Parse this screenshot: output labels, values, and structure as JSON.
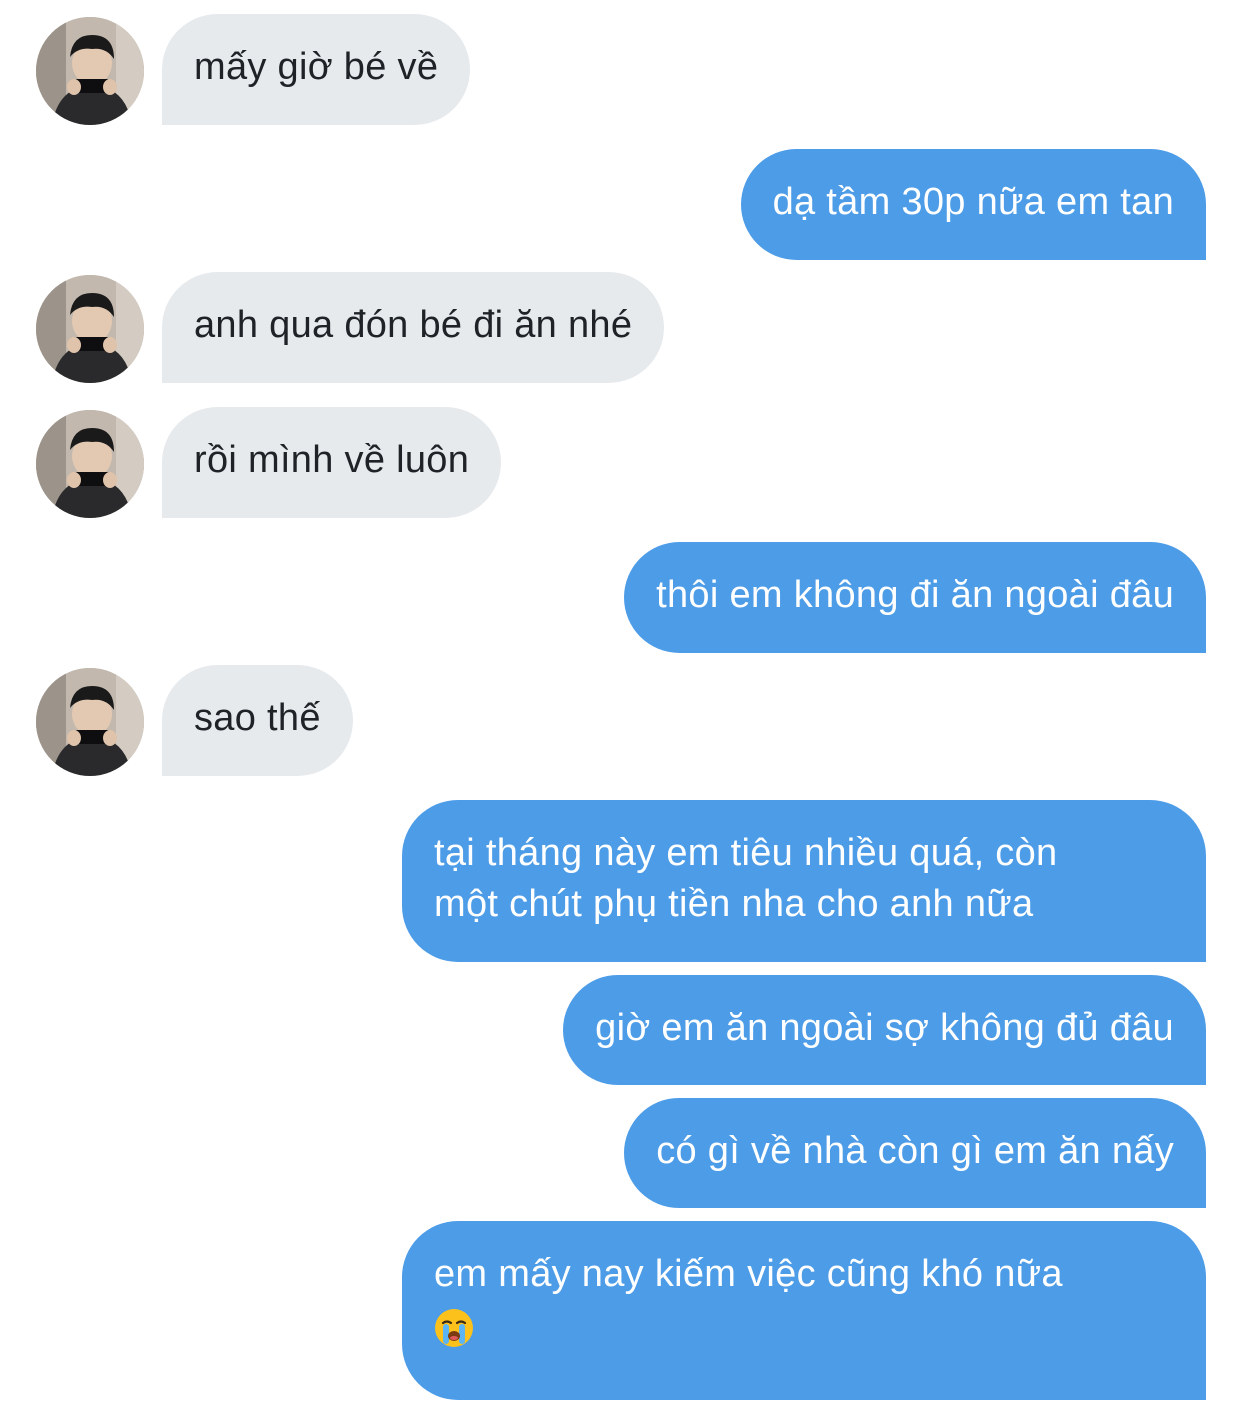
{
  "conversation": {
    "messages": [
      {
        "direction": "incoming",
        "text": "mấy giờ bé về"
      },
      {
        "direction": "outgoing",
        "text": "dạ tầm 30p nữa em tan"
      },
      {
        "direction": "incoming",
        "text": "anh qua đón bé đi ăn nhé"
      },
      {
        "direction": "incoming",
        "text": "rồi mình về luôn"
      },
      {
        "direction": "outgoing",
        "text": "thôi em không đi ăn ngoài đâu"
      },
      {
        "direction": "incoming",
        "text": "sao thế"
      },
      {
        "direction": "outgoing",
        "lines": [
          "tại tháng này em tiêu nhiều quá, còn",
          "một chút phụ tiền nha cho anh nữa"
        ]
      },
      {
        "direction": "outgoing",
        "text": "giờ em ăn ngoài sợ không đủ đâu"
      },
      {
        "direction": "outgoing",
        "text": "có gì về nhà còn gì em ăn nấy"
      },
      {
        "direction": "outgoing",
        "text": "em mấy nay kiếm việc cũng khó nữa",
        "emoji": "😭"
      }
    ]
  },
  "colors": {
    "incoming_bubble": "#e7eaed",
    "outgoing_bubble": "#4d9ce8",
    "incoming_text": "#1f2226",
    "outgoing_text": "#ffffff"
  }
}
